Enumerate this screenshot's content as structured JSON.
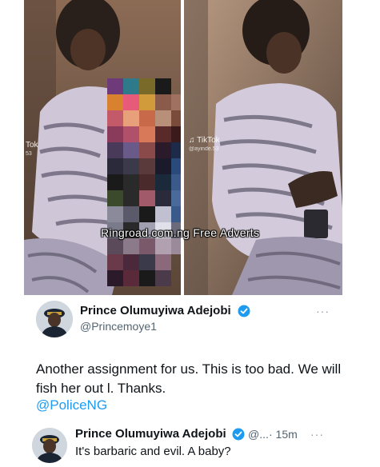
{
  "media": {
    "overlay_text": "Ringroad.com.ng Free Adverts",
    "left_watermark_label": "Tok",
    "left_watermark_handle": "53",
    "right_watermark_label": "TikTok",
    "right_watermark_handle": "@ayinde.53"
  },
  "tweet": {
    "author_name": "Prince Olumuyiwa Adejobi",
    "author_handle": "@Princemoye1",
    "text": "Another assignment for us. This is too bad. We will fish her out l. Thanks.",
    "mention": "@PoliceNG",
    "more_label": "···"
  },
  "reply": {
    "author_name": "Prince Olumuyiwa Adejobi",
    "author_handle": "@...",
    "time": "· 15m",
    "text": "It's barbaric and evil. A baby?",
    "more_label": "···"
  },
  "colors": {
    "verified_badge": "#1d9bf0",
    "link": "#1d9bf0",
    "muted": "#536471"
  }
}
